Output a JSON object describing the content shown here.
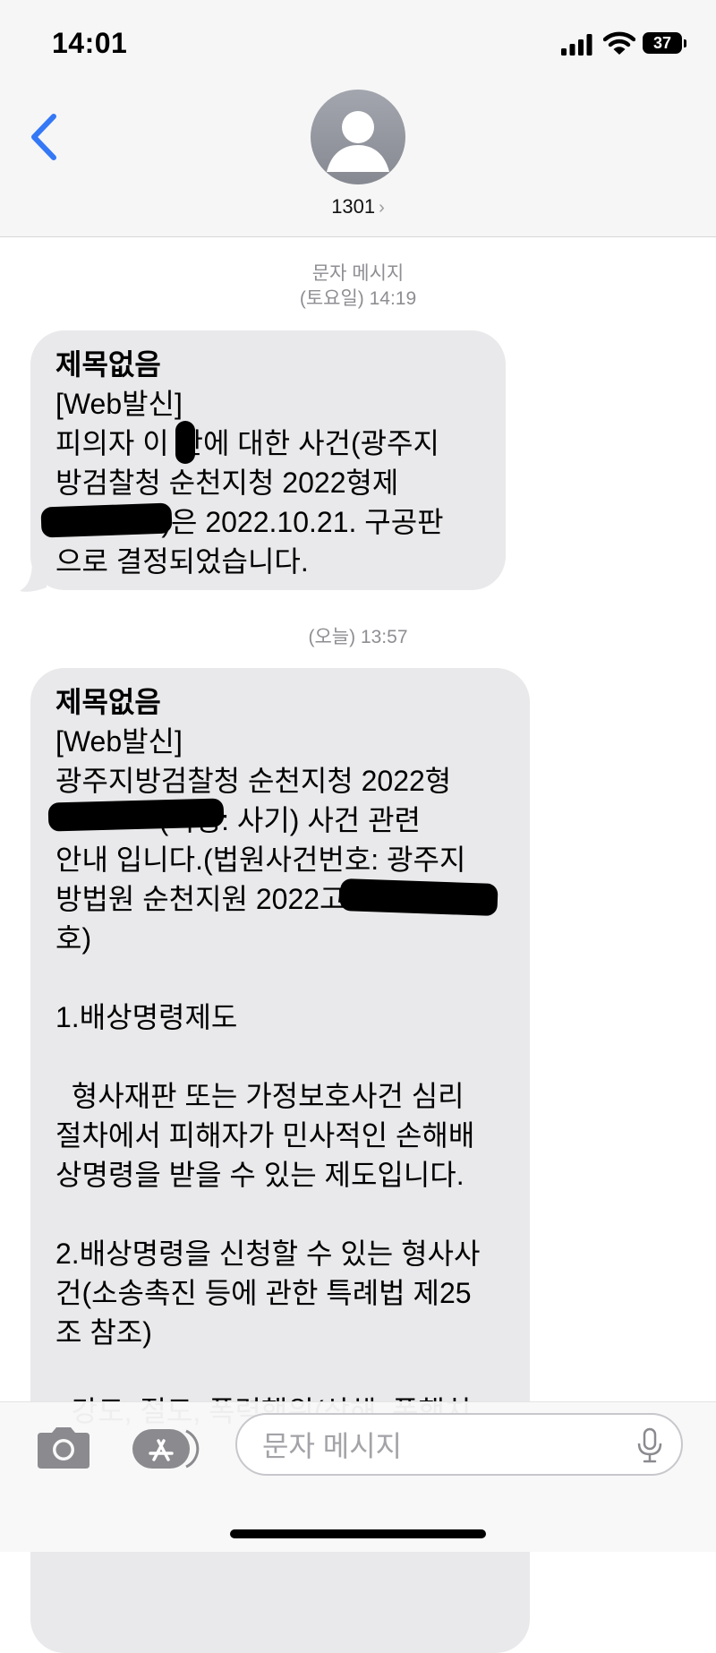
{
  "status_bar": {
    "time": "14:01",
    "battery": "37"
  },
  "header": {
    "contact_name": "1301",
    "chevron": "›"
  },
  "conversation": {
    "timestamps": [
      {
        "label": "문자 메시지",
        "time": "(토요일) 14:19"
      },
      {
        "label": "",
        "time": "(오늘) 13:57"
      }
    ],
    "messages": [
      {
        "title": "제목없음",
        "body": "[Web발신]\n피의자 이 찬에 대한 사건(광주지\n방검찰청 순천지청 2022형제\n          호)은 2022.10.21. 구공판\n으로 결정되었습니다."
      },
      {
        "title": "제목없음",
        "body": "[Web발신]\n광주지방검찰청 순천지청 2022형\n             (죄명: 사기) 사건 관련\n안내 입니다.(법원사건번호: 광주지\n방법원 순천지원 2022고\n호)\n\n1.배상명령제도\n\n  형사재판 또는 가정보호사건 심리\n절차에서 피해자가 민사적인 손해배\n상명령을 받을 수 있는 제도입니다.\n\n2.배상명령을 신청할 수 있는 형사사\n건(소송촉진 등에 관한 특례법 제25\n조 참조)\n\n  강도, 절도, 폭력행위(상해, 폭행치"
      }
    ]
  },
  "input_bar": {
    "placeholder": "문자 메시지"
  },
  "colors": {
    "accent": "#3478f6",
    "bubble": "#e9e9eb",
    "timestamp": "#8e8e93"
  }
}
